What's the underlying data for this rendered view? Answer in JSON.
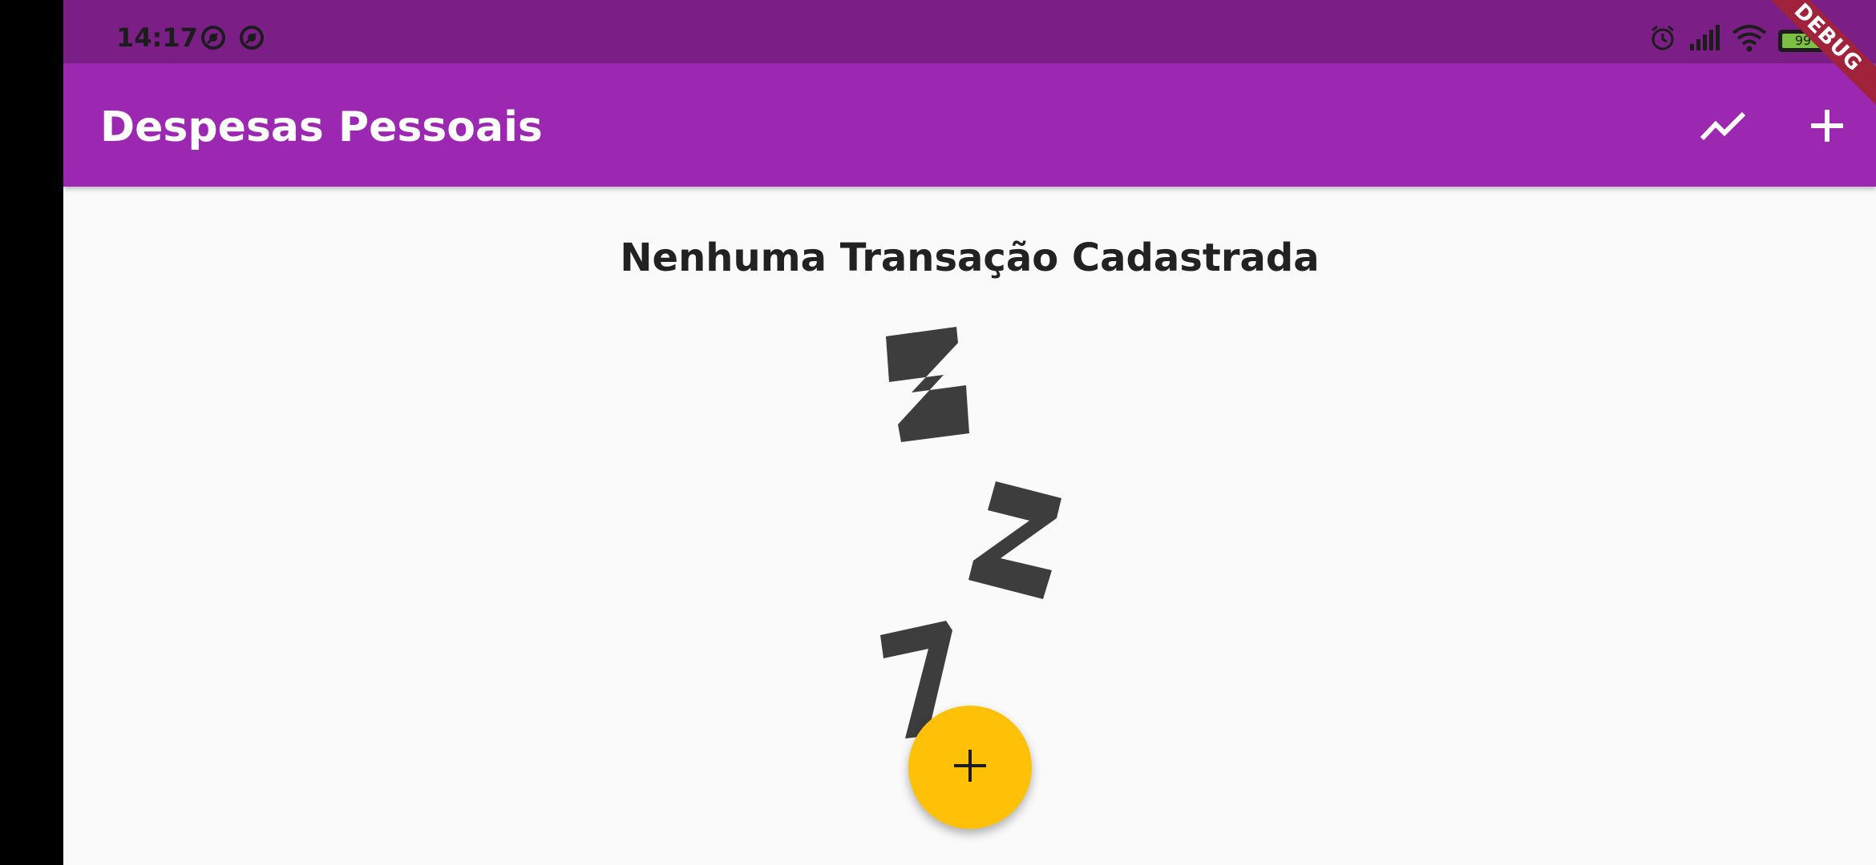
{
  "status_bar": {
    "time": "14:17",
    "battery_level": "99",
    "battery_fraction": 0.99,
    "left_icons": [
      "sync-icon",
      "sync-icon"
    ],
    "right_icons": [
      "alarm-icon",
      "signal-icon",
      "wifi-icon",
      "battery-icon"
    ]
  },
  "app_bar": {
    "title": "Despesas Pessoais",
    "actions": [
      "chart-icon",
      "add-icon"
    ],
    "color": "#9c27b0"
  },
  "debug_banner": "DEBUG",
  "empty_state": {
    "title": "Nenhuma Transação Cadastrada",
    "image": "sleeping-zzz-icon"
  },
  "fab": {
    "icon": "add-icon",
    "color": "#ffc107"
  }
}
